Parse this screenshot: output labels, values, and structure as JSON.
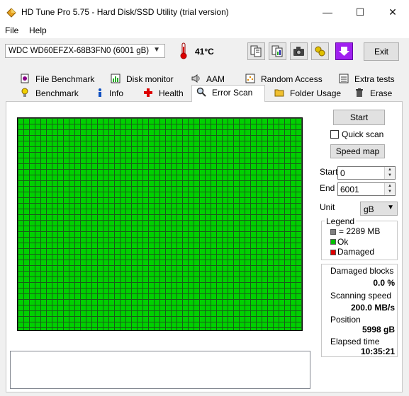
{
  "window": {
    "title": "HD Tune Pro 5.75 - Hard Disk/SSD Utility (trial version)",
    "minimize_glyph": "—",
    "maximize_glyph": "☐",
    "close_glyph": "✕"
  },
  "menu": {
    "file": "File",
    "help": "Help"
  },
  "toolbar": {
    "drive": "WDC WD60EFZX-68B3FN0 (6001 gB)",
    "temperature": "41°C",
    "exit_label": "Exit"
  },
  "tabs": {
    "row1": [
      {
        "label": "File Benchmark",
        "icon": "file-benchmark-icon"
      },
      {
        "label": "Disk monitor",
        "icon": "disk-monitor-icon"
      },
      {
        "label": "AAM",
        "icon": "speaker-icon"
      },
      {
        "label": "Random Access",
        "icon": "random-access-icon"
      },
      {
        "label": "Extra tests",
        "icon": "extra-tests-icon"
      }
    ],
    "row2": [
      {
        "label": "Benchmark",
        "icon": "bulb-icon"
      },
      {
        "label": "Info",
        "icon": "info-icon"
      },
      {
        "label": "Health",
        "icon": "health-cross-icon"
      },
      {
        "label": "Error Scan",
        "icon": "magnifier-icon",
        "active": true
      },
      {
        "label": "Folder Usage",
        "icon": "folder-icon"
      },
      {
        "label": "Erase",
        "icon": "trash-icon"
      }
    ]
  },
  "scan": {
    "start_button": "Start",
    "quick_scan_label": "Quick scan",
    "quick_scan_checked": false,
    "speed_map_button": "Speed map",
    "start_label": "Start",
    "start_value": "0",
    "end_label": "End",
    "end_value": "6001",
    "unit_label": "Unit",
    "unit_value": "gB",
    "block_state": "ok"
  },
  "legend": {
    "title": "Legend",
    "items": [
      {
        "label": "= 2289 MB",
        "color": "#808080"
      },
      {
        "label": "Ok",
        "color": "#00c000"
      },
      {
        "label": "Damaged",
        "color": "#e00000"
      }
    ]
  },
  "stats": {
    "damaged_blocks_label": "Damaged blocks",
    "damaged_blocks_value": "0.0 %",
    "scanning_speed_label": "Scanning speed",
    "scanning_speed_value": "200.0 MB/s",
    "position_label": "Position",
    "position_value": "5998 gB",
    "elapsed_time_label": "Elapsed time",
    "elapsed_time_value": "10:35:21"
  },
  "colors": {
    "ok_block": "#00d000",
    "grid_line": "#1a5a1a",
    "accent_button": "#a020f0"
  }
}
